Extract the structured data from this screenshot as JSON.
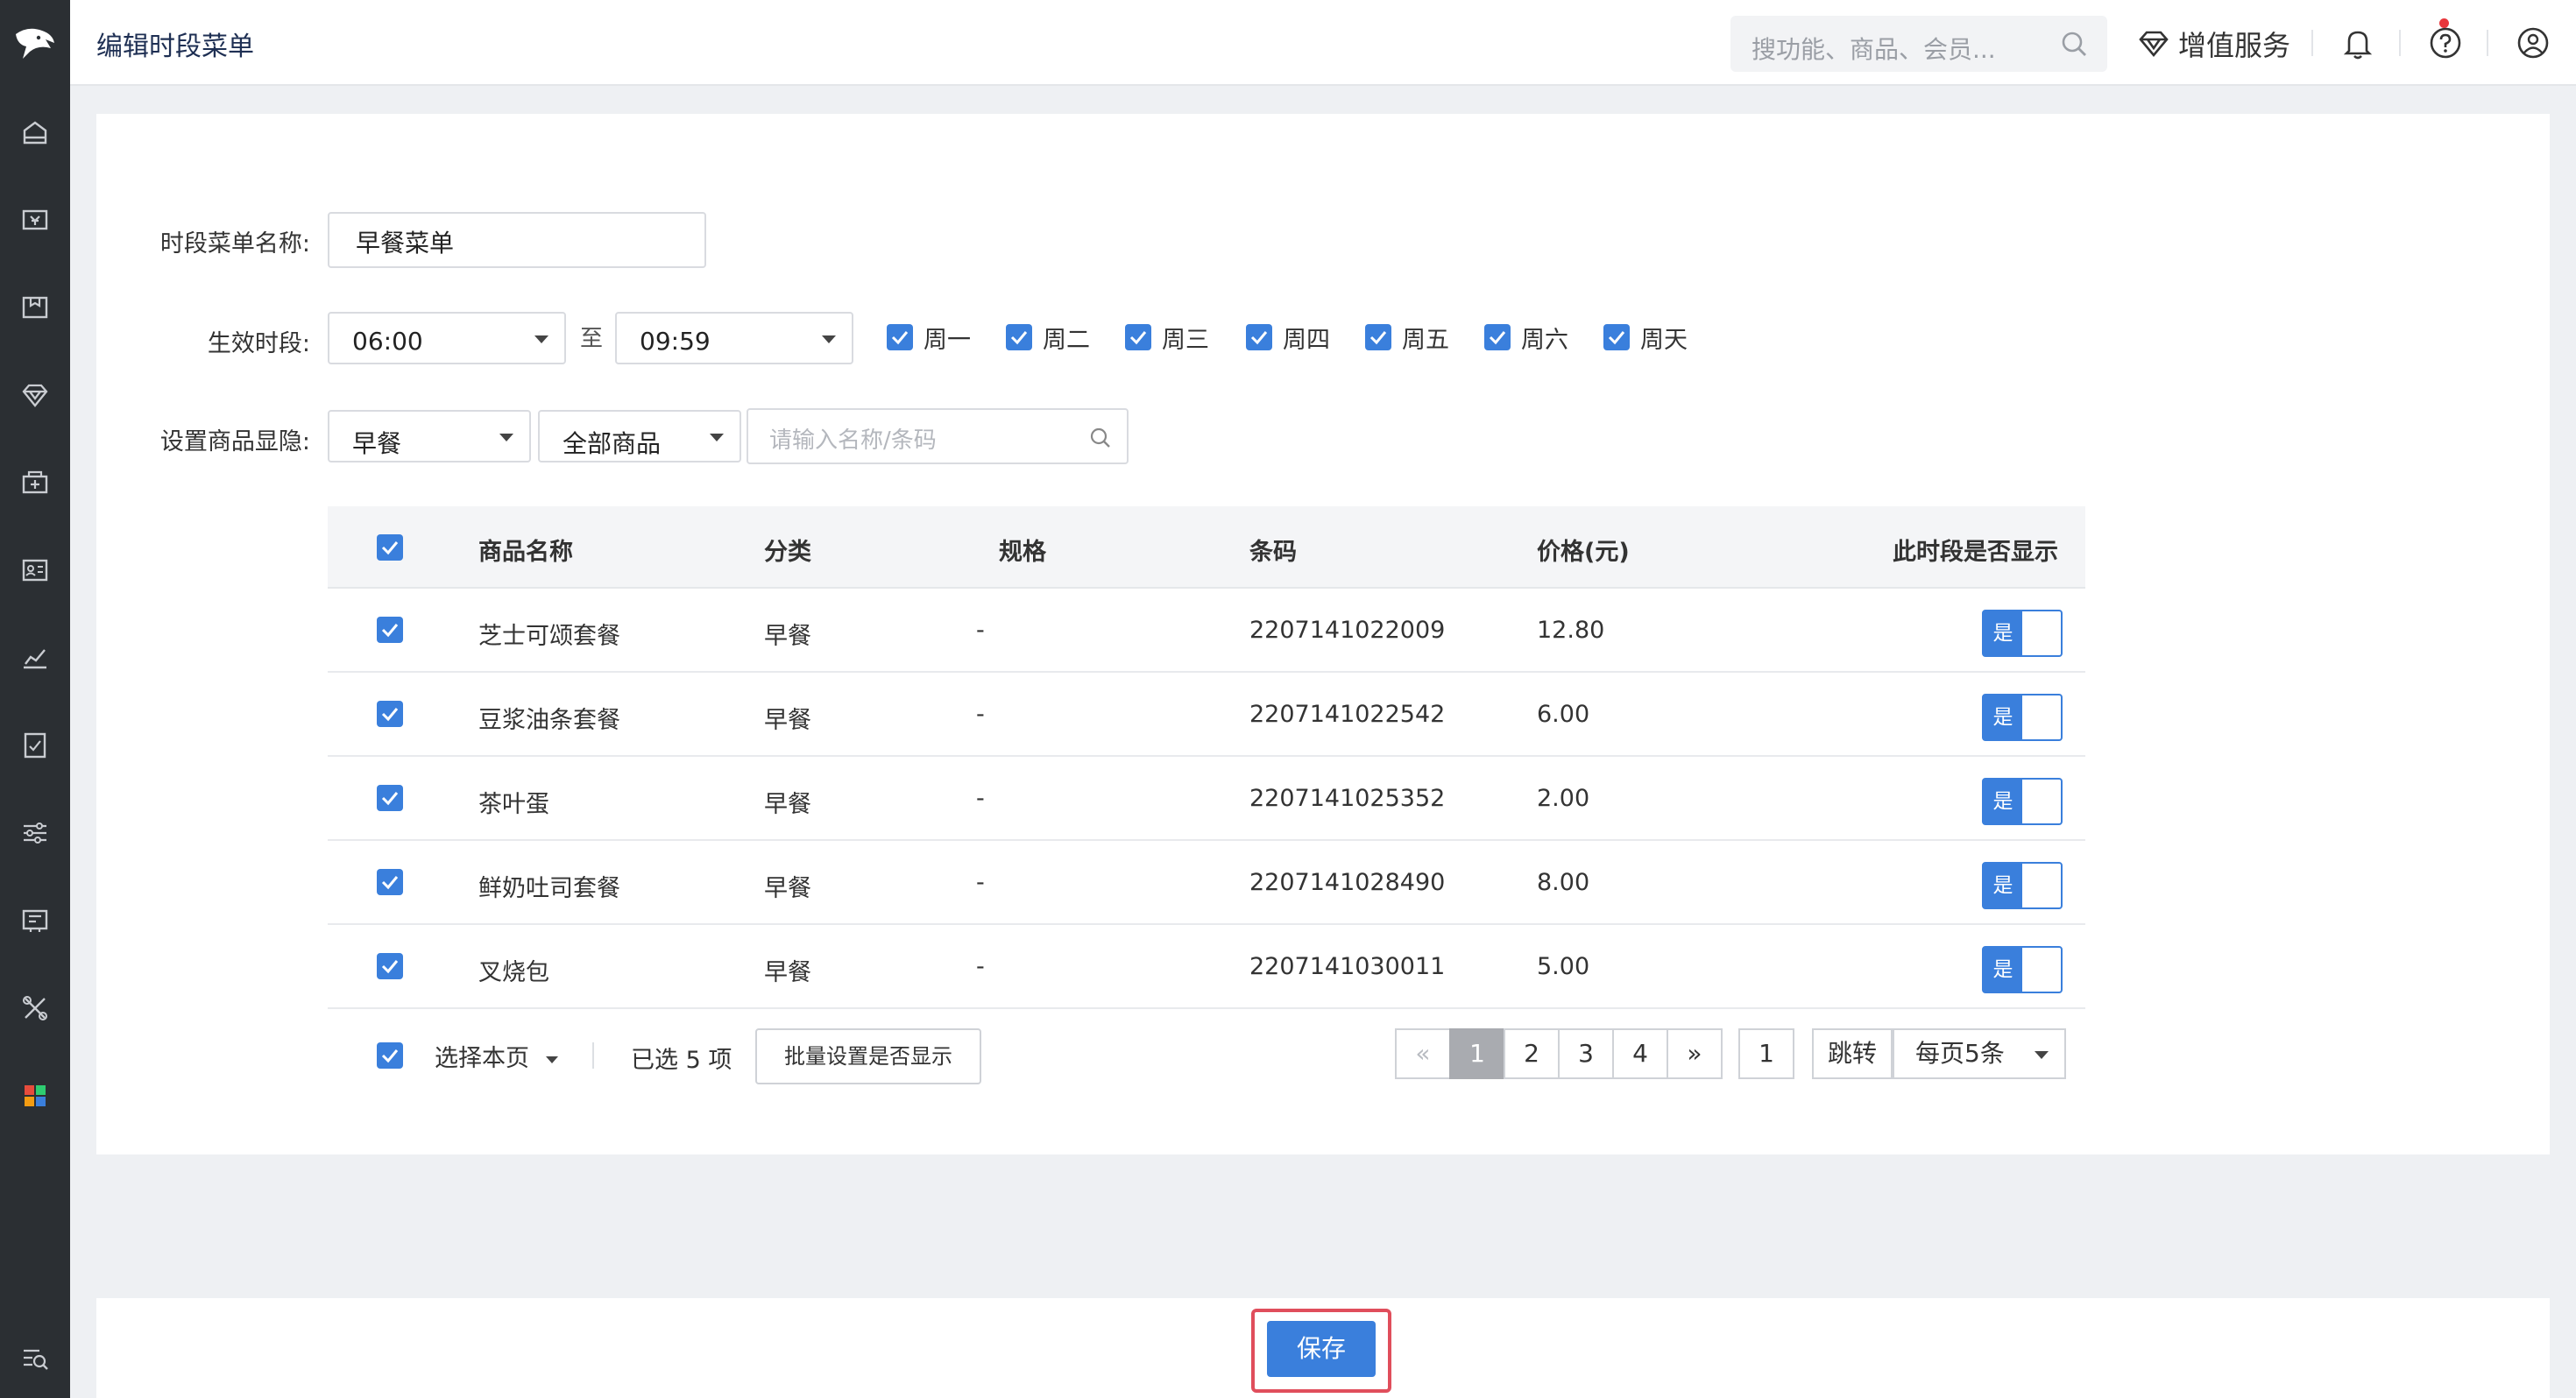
{
  "header": {
    "title": "编辑时段菜单",
    "search_placeholder": "搜功能、商品、会员...",
    "value_added_service": "增值服务"
  },
  "form": {
    "name_label": "时段菜单名称:",
    "name_value": "早餐菜单",
    "time_label": "生效时段:",
    "start_time": "06:00",
    "to_label": "至",
    "end_time": "09:59",
    "days": [
      "周一",
      "周二",
      "周三",
      "周四",
      "周五",
      "周六",
      "周天"
    ],
    "visibility_label": "设置商品显隐:",
    "category_select": "早餐",
    "product_select": "全部商品",
    "search_placeholder": "请输入名称/条码"
  },
  "table": {
    "headers": [
      "商品名称",
      "分类",
      "规格",
      "条码",
      "价格(元)",
      "此时段是否显示"
    ],
    "rows": [
      {
        "name": "芝士可颂套餐",
        "category": "早餐",
        "spec": "-",
        "barcode": "2207141022009",
        "price": "12.80",
        "show": "是"
      },
      {
        "name": "豆浆油条套餐",
        "category": "早餐",
        "spec": "-",
        "barcode": "2207141022542",
        "price": "6.00",
        "show": "是"
      },
      {
        "name": "茶叶蛋",
        "category": "早餐",
        "spec": "-",
        "barcode": "2207141025352",
        "price": "2.00",
        "show": "是"
      },
      {
        "name": "鲜奶吐司套餐",
        "category": "早餐",
        "spec": "-",
        "barcode": "2207141028490",
        "price": "8.00",
        "show": "是"
      },
      {
        "name": "叉烧包",
        "category": "早餐",
        "spec": "-",
        "barcode": "2207141030011",
        "price": "5.00",
        "show": "是"
      }
    ]
  },
  "footer": {
    "select_page": "选择本页",
    "selected_text": "已选 5 项",
    "batch_button": "批量设置是否显示",
    "pages": [
      "«",
      "1",
      "2",
      "3",
      "4",
      "»"
    ],
    "jump_value": "1",
    "jump_button": "跳转",
    "per_page": "每页5条"
  },
  "save_button": "保存",
  "colors": {
    "accent": "#3a7fdc",
    "sidebar": "#2b2f33",
    "highlight": "#e04e5c"
  }
}
